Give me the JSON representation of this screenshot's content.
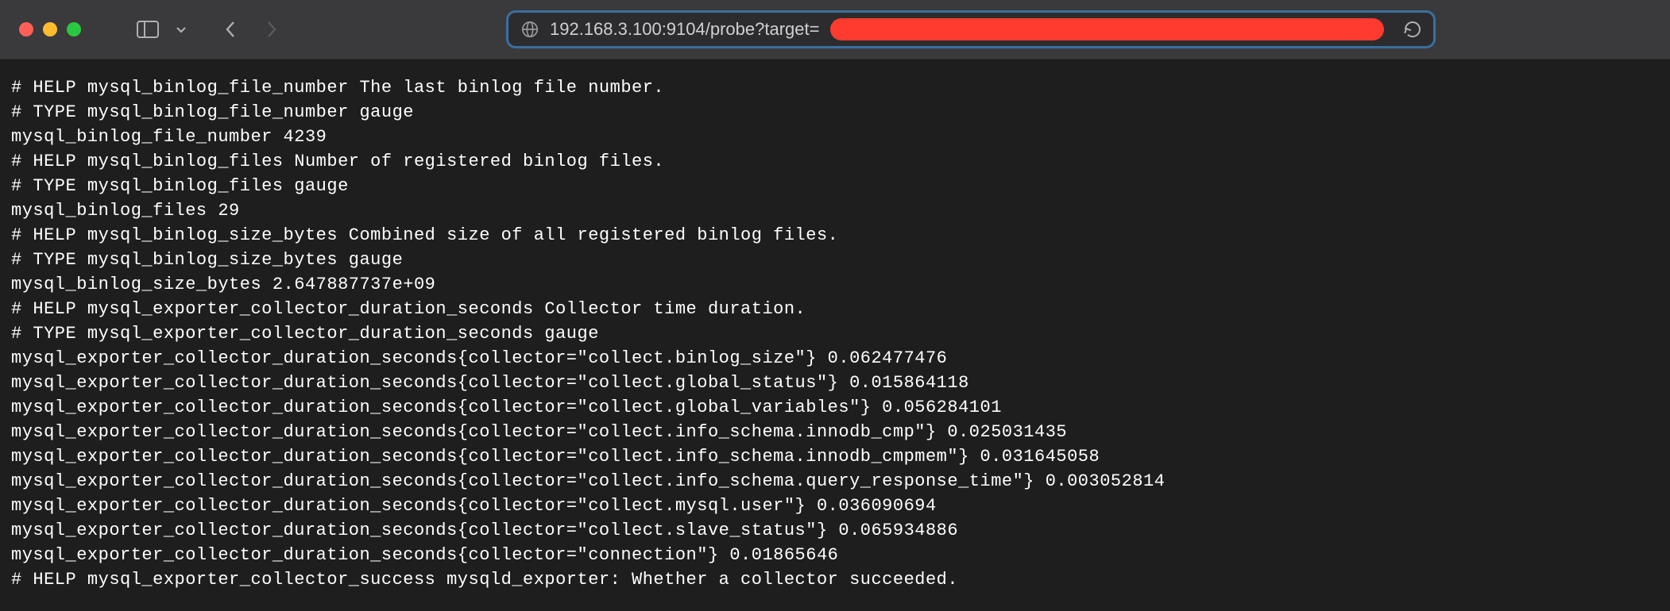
{
  "toolbar": {
    "url_visible": "192.168.3.100:9104/probe?target="
  },
  "metrics": {
    "lines": [
      "# HELP mysql_binlog_file_number The last binlog file number.",
      "# TYPE mysql_binlog_file_number gauge",
      "mysql_binlog_file_number 4239",
      "# HELP mysql_binlog_files Number of registered binlog files.",
      "# TYPE mysql_binlog_files gauge",
      "mysql_binlog_files 29",
      "# HELP mysql_binlog_size_bytes Combined size of all registered binlog files.",
      "# TYPE mysql_binlog_size_bytes gauge",
      "mysql_binlog_size_bytes 2.647887737e+09",
      "# HELP mysql_exporter_collector_duration_seconds Collector time duration.",
      "# TYPE mysql_exporter_collector_duration_seconds gauge",
      "mysql_exporter_collector_duration_seconds{collector=\"collect.binlog_size\"} 0.062477476",
      "mysql_exporter_collector_duration_seconds{collector=\"collect.global_status\"} 0.015864118",
      "mysql_exporter_collector_duration_seconds{collector=\"collect.global_variables\"} 0.056284101",
      "mysql_exporter_collector_duration_seconds{collector=\"collect.info_schema.innodb_cmp\"} 0.025031435",
      "mysql_exporter_collector_duration_seconds{collector=\"collect.info_schema.innodb_cmpmem\"} 0.031645058",
      "mysql_exporter_collector_duration_seconds{collector=\"collect.info_schema.query_response_time\"} 0.003052814",
      "mysql_exporter_collector_duration_seconds{collector=\"collect.mysql.user\"} 0.036090694",
      "mysql_exporter_collector_duration_seconds{collector=\"collect.slave_status\"} 0.065934886",
      "mysql_exporter_collector_duration_seconds{collector=\"connection\"} 0.01865646",
      "# HELP mysql_exporter_collector_success mysqld_exporter: Whether a collector succeeded."
    ]
  }
}
